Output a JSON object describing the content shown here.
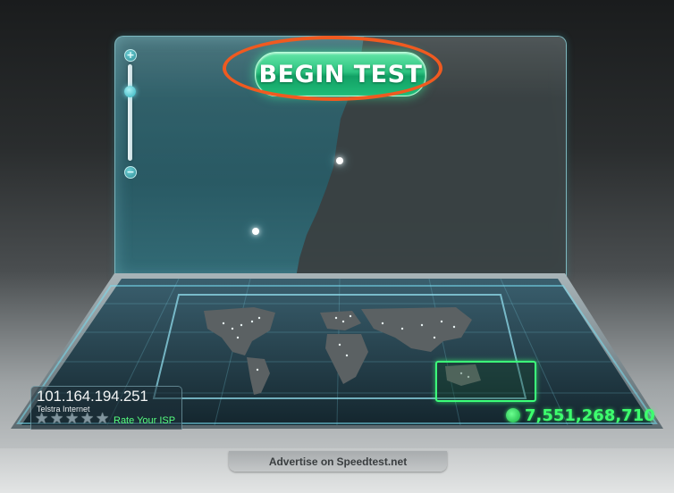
{
  "begin_test": {
    "label": "BEGIN TEST"
  },
  "map_controls": {
    "zoom_in_label": "+",
    "zoom_out_label": "−"
  },
  "isp": {
    "ip": "101.164.194.251",
    "name": "Telstra Internet",
    "rate_label": "Rate Your ISP",
    "rating_stars_max": 5,
    "star_glyph": "★"
  },
  "tests_count": "7,551,268,710",
  "advertise": {
    "prefix": "Advertise on ",
    "site": "Speedtest.net"
  },
  "colors": {
    "accent_green": "#3dff6e",
    "highlight_orange": "#f05a20",
    "glass_teal": "#2e6e78"
  },
  "icons": [
    "zoom-in-icon",
    "zoom-out-icon",
    "globe-icon",
    "star-icon"
  ]
}
